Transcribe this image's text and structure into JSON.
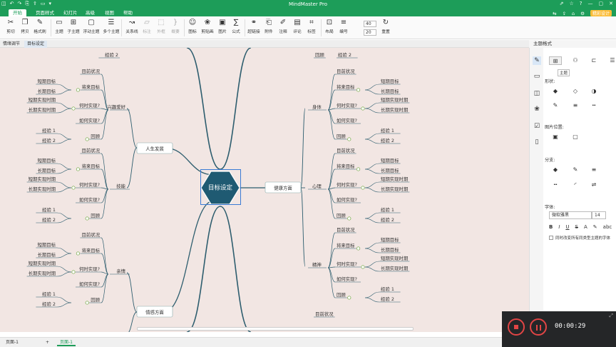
{
  "window": {
    "title": "MindMaster Pro",
    "quick_access": [
      "◫",
      "↶",
      "↷",
      "⎘",
      "⇪",
      "▭",
      "▾"
    ],
    "controls": [
      "⇗",
      "☆",
      "?",
      "—",
      "▢",
      "✕"
    ]
  },
  "menu": {
    "tabs": [
      "开始",
      "页面样式",
      "幻灯片",
      "高级",
      "视图",
      "帮助"
    ],
    "active": "开始",
    "right_icons": [
      "⇆",
      "⇪",
      "⌂",
      "⚙"
    ],
    "design_label": "精彩设计"
  },
  "ribbon": {
    "buttons": [
      {
        "label": "剪切",
        "icon": "✂"
      },
      {
        "label": "拷贝",
        "icon": "❐"
      },
      {
        "label": "格式刷",
        "icon": "✎"
      },
      {
        "label": "主题",
        "icon": "▭"
      },
      {
        "label": "子主题",
        "icon": "⊞"
      },
      {
        "label": "浮动主题",
        "icon": "▢"
      },
      {
        "label": "多个主题",
        "icon": "☰"
      },
      {
        "label": "关系线",
        "icon": "↝"
      },
      {
        "label": "标注",
        "icon": "▱"
      },
      {
        "label": "外框",
        "icon": "⬚"
      },
      {
        "label": "概要",
        "icon": "}"
      },
      {
        "label": "图标",
        "icon": "☺"
      },
      {
        "label": "剪贴画",
        "icon": "❀"
      },
      {
        "label": "图片",
        "icon": "▣"
      },
      {
        "label": "公式",
        "icon": "∑"
      },
      {
        "label": "超链接",
        "icon": "⚭"
      },
      {
        "label": "附件",
        "icon": "⎗"
      },
      {
        "label": "注释",
        "icon": "✐"
      },
      {
        "label": "评论",
        "icon": "▤"
      },
      {
        "label": "标签",
        "icon": "⌗"
      },
      {
        "label": "布局",
        "icon": "⊡"
      },
      {
        "label": "编号",
        "icon": "≡"
      },
      {
        "label": "重置",
        "icon": "↻"
      }
    ],
    "spin1": "40",
    "spin2": "20"
  },
  "doc_tabs": [
    "情绪调节",
    "目标设定"
  ],
  "active_doc": "目标设定",
  "mindmap": {
    "center": "目标设定",
    "main": [
      "人生发展",
      "健康方面",
      "情感方面"
    ],
    "sub": [
      "兴趣爱好",
      "技能",
      "亲情",
      "身体",
      "心理",
      "精神"
    ],
    "leaf": [
      "目前状况",
      "将来目标",
      "短期目标",
      "长期目标",
      "何时实现?",
      "短期实现时期",
      "长期实现时期",
      "如何实现?",
      "回顾",
      "经验 1",
      "经验 2"
    ]
  },
  "panel": {
    "header": "主题格式",
    "tooltip": "主题",
    "shape_label": "形状:",
    "image_label": "图片位置:",
    "branch_label": "分支:",
    "font_label": "字体:",
    "font_name": "微软雅黑",
    "font_size": "14",
    "format_buttons": [
      "B",
      "I",
      "U",
      "S",
      "A",
      "✎",
      "abc"
    ],
    "checkbox": "同时改变所有同类型主题的字体"
  },
  "recorder": {
    "time": "00:00:29",
    "icon": "⤢"
  },
  "status": {
    "pages": [
      "页面-1",
      "页面-1"
    ],
    "add": "+"
  },
  "colors": {
    "brand": "#1d9d59",
    "canvas": "#f2e6e3",
    "center": "#1f5a72",
    "branch": "#2d5d6e",
    "record": "#e24545"
  }
}
